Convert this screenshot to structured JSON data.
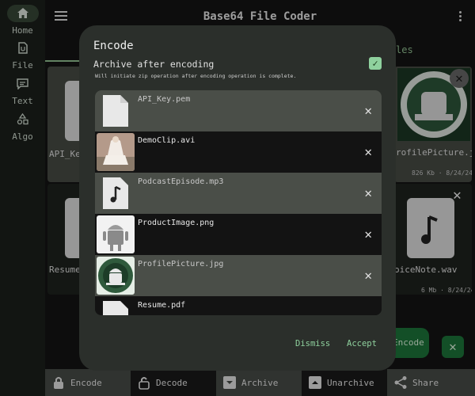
{
  "app": {
    "title": "Base64 File Coder"
  },
  "rail": {
    "items": [
      {
        "label": "Home",
        "icon": "home-icon",
        "active": true
      },
      {
        "label": "File",
        "icon": "file-icon"
      },
      {
        "label": "Text",
        "icon": "text-icon"
      },
      {
        "label": "Algo",
        "icon": "algo-icon"
      }
    ]
  },
  "tabs": {
    "files_partial": "les"
  },
  "background_tiles": [
    {
      "name": "API_Key"
    },
    {
      "name": "rofilePicture.jp",
      "meta": "826 Kb · 8/24/24"
    },
    {
      "name": "Resume."
    },
    {
      "name": "oiceNote.wav",
      "meta": "6 Mb · 8/24/24"
    }
  ],
  "bottom_bar": {
    "buttons": [
      {
        "label": "Encode",
        "icon": "lock-icon"
      },
      {
        "label": "Decode",
        "icon": "unlock-icon"
      },
      {
        "label": "Archive",
        "icon": "archive-icon"
      },
      {
        "label": "Unarchive",
        "icon": "unarchive-icon"
      },
      {
        "label": "Share",
        "icon": "share-icon"
      }
    ]
  },
  "fab": {
    "encode_label": "Encode",
    "close_symbol": "✕"
  },
  "dialog": {
    "title": "Encode",
    "archive_label": "Archive after encoding",
    "archive_checked": true,
    "archive_desc": "Will initiate zip operation after encoding operation is complete.",
    "files": [
      {
        "name": "API_Key.pem",
        "thumb": "document-icon",
        "dim": true
      },
      {
        "name": "DemoClip.avi",
        "thumb": "video-thumbnail"
      },
      {
        "name": "PodcastEpisode.mp3",
        "thumb": "audio-file-icon",
        "dim": true
      },
      {
        "name": "ProductImage.png",
        "thumb": "android-image"
      },
      {
        "name": "ProfilePicture.jpg",
        "thumb": "android-circuit-image",
        "dim": true
      },
      {
        "name": "Resume.pdf",
        "thumb": "document-icon"
      }
    ],
    "dismiss_label": "Dismiss",
    "accept_label": "Accept"
  },
  "colors": {
    "accent": "#8fd19e",
    "fab": "#1e7a3c",
    "dialog_bg": "#2b2f2b"
  }
}
